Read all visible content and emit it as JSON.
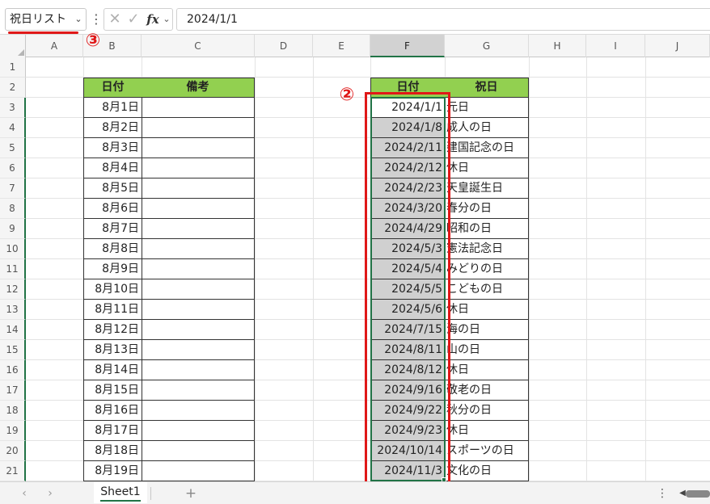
{
  "formula_bar": {
    "name_box": "祝日リスト",
    "chevron": "⌄",
    "more": "⋮",
    "cancel": "✕",
    "enter": "✓",
    "fx": "fx",
    "fx_chevron": "⌄",
    "value": "2024/1/1"
  },
  "columns": [
    "A",
    "B",
    "C",
    "D",
    "E",
    "F",
    "G",
    "H",
    "I",
    "J"
  ],
  "rows": [
    "1",
    "2",
    "3",
    "4",
    "5",
    "6",
    "7",
    "8",
    "9",
    "10",
    "11",
    "12",
    "13",
    "14",
    "15",
    "16",
    "17",
    "18",
    "19",
    "20",
    "21"
  ],
  "table1": {
    "header_date": "日付",
    "header_note": "備考",
    "dates": [
      "8月1日",
      "8月2日",
      "8月3日",
      "8月4日",
      "8月5日",
      "8月6日",
      "8月7日",
      "8月8日",
      "8月9日",
      "8月10日",
      "8月11日",
      "8月12日",
      "8月13日",
      "8月14日",
      "8月15日",
      "8月16日",
      "8月17日",
      "8月18日",
      "8月19日"
    ]
  },
  "table2": {
    "header_date": "日付",
    "header_holiday": "祝日",
    "rows": [
      {
        "date": "2024/1/1",
        "name": "元日"
      },
      {
        "date": "2024/1/8",
        "name": "成人の日"
      },
      {
        "date": "2024/2/11",
        "name": "建国記念の日"
      },
      {
        "date": "2024/2/12",
        "name": "休日"
      },
      {
        "date": "2024/2/23",
        "name": "天皇誕生日"
      },
      {
        "date": "2024/3/20",
        "name": "春分の日"
      },
      {
        "date": "2024/4/29",
        "name": "昭和の日"
      },
      {
        "date": "2024/5/3",
        "name": "憲法記念日"
      },
      {
        "date": "2024/5/4",
        "name": "みどりの日"
      },
      {
        "date": "2024/5/5",
        "name": "こどもの日"
      },
      {
        "date": "2024/5/6",
        "name": "休日"
      },
      {
        "date": "2024/7/15",
        "name": "海の日"
      },
      {
        "date": "2024/8/11",
        "name": "山の日"
      },
      {
        "date": "2024/8/12",
        "name": "休日"
      },
      {
        "date": "2024/9/16",
        "name": "敬老の日"
      },
      {
        "date": "2024/9/22",
        "name": "秋分の日"
      },
      {
        "date": "2024/9/23",
        "name": "休日"
      },
      {
        "date": "2024/10/14",
        "name": "スポーツの日"
      },
      {
        "date": "2024/11/3",
        "name": "文化の日"
      }
    ]
  },
  "annotations": {
    "step2": "②",
    "step3": "③"
  },
  "colors": {
    "accent_green": "#217346",
    "header_fill": "#92d050",
    "annotation_red": "#e01818",
    "selection_fill": "#d0d0d0"
  },
  "sheet_bar": {
    "prev": "‹",
    "next": "›",
    "tab": "Sheet1",
    "add": "+",
    "more": "⋮",
    "scroll_left": "◀"
  }
}
